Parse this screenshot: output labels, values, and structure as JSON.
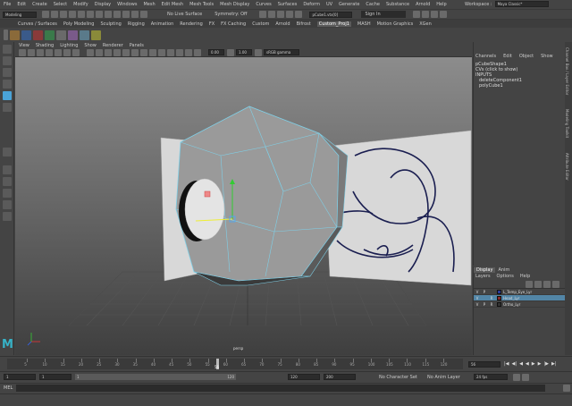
{
  "menubar": {
    "items": [
      "File",
      "Edit",
      "Create",
      "Select",
      "Modify",
      "Display",
      "Windows",
      "Mesh",
      "Edit Mesh",
      "Mesh Tools",
      "Mesh Display",
      "Curves",
      "Surfaces",
      "Deform",
      "UV",
      "Generate",
      "Cache",
      "Substance",
      "Arnold",
      "Help"
    ],
    "workspace_label": "Workspace :",
    "workspace_value": "Maya Classic*"
  },
  "statusline": {
    "mode": "Modeling",
    "live_surface": "No Live Surface",
    "symmetry": "Symmetry: Off",
    "search_value": "pCube1.vtx[0]",
    "sign_in": "Sign In"
  },
  "shelf": {
    "tabs": [
      "Curves / Surfaces",
      "Poly Modeling",
      "Sculpting",
      "Rigging",
      "Animation",
      "Rendering",
      "FX",
      "FX Caching",
      "Custom",
      "Arnold",
      "Bifrost",
      "Custom_Proj1",
      "MASH",
      "Motion Graphics",
      "XGen"
    ],
    "active_tab": "Custom_Proj1"
  },
  "viewport": {
    "menu": [
      "View",
      "Shading",
      "Lighting",
      "Show",
      "Renderer",
      "Panels"
    ],
    "field_a": "0.00",
    "field_b": "1.00",
    "color_space": "sRGB gamma",
    "camera_label": "persp"
  },
  "channel_box": {
    "tabs": [
      "Channels",
      "Edit",
      "Object",
      "Show"
    ],
    "items": [
      "pCubeShape1",
      "CVs (click to show)",
      "INPUTS",
      "deleteComponent1",
      "polyCube1"
    ]
  },
  "layer_editor": {
    "tabs": [
      "Display",
      "Anim"
    ],
    "menu": [
      "Layers",
      "Options",
      "Help"
    ],
    "layers": [
      {
        "v": "V",
        "p": "P",
        "r": "",
        "color": "#2a3a9a",
        "name": "L_Temp_Eye_Lyr",
        "selected": false
      },
      {
        "v": "V",
        "p": "",
        "r": "R",
        "color": "#8a2a2a",
        "name": "Head_Lyr",
        "selected": true
      },
      {
        "v": "V",
        "p": "P",
        "r": "R",
        "color": "#333333",
        "name": "Ortho_Lyr",
        "selected": false
      }
    ]
  },
  "side_tabs": [
    "Channel Box / Layer Editor",
    "Modeling Toolkit",
    "Attribute Editor"
  ],
  "timeline": {
    "ticks": [
      "5",
      "10",
      "15",
      "20",
      "25",
      "30",
      "35",
      "40",
      "45",
      "50",
      "55",
      "60",
      "65",
      "70",
      "75",
      "80",
      "85",
      "90",
      "95",
      "100",
      "105",
      "110",
      "115",
      "120"
    ],
    "current_frame": "56",
    "current_field": "56"
  },
  "range_bar": {
    "start": "1",
    "start_inner": "1",
    "range_start_marker": "1",
    "range_end_marker": "120",
    "end_inner": "120",
    "end": "200",
    "character_set": "No Character Set",
    "anim_layer": "No Anim Layer",
    "fps": "24 fps"
  },
  "command_line": {
    "label": "MEL"
  },
  "colors": {
    "accent": "#4aa3d8",
    "wire": "#7fd0e8",
    "bg": "#444444",
    "viewport_top": "#8a8a8a",
    "viewport_bottom": "#3a3a3a"
  }
}
